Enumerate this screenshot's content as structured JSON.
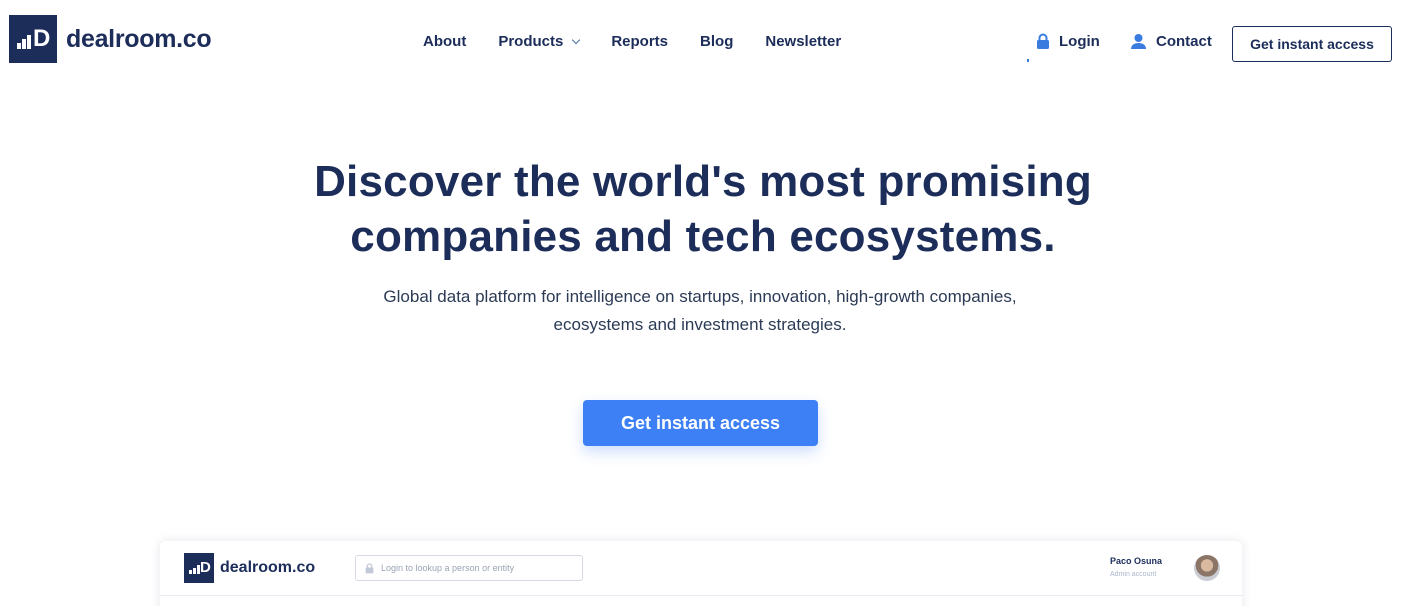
{
  "header": {
    "logo_text": "dealroom.co",
    "logo_mark_letter": "D",
    "nav": [
      {
        "label": "About"
      },
      {
        "label": "Products",
        "has_dropdown": true
      },
      {
        "label": "Reports"
      },
      {
        "label": "Blog"
      },
      {
        "label": "Newsletter"
      }
    ],
    "login_label": "Login",
    "contact_label": "Contact",
    "cta_label": "Get instant access",
    "icons": {
      "login": "lock-icon",
      "contact": "user-icon",
      "dropdown": "chevron-down-icon"
    }
  },
  "hero": {
    "title_line1": "Discover the world's most promising",
    "title_line2": "companies and tech ecosystems.",
    "subtitle_line1": "Global data platform for intelligence on startups, innovation, high-growth companies,",
    "subtitle_line2": "ecosystems and investment strategies.",
    "cta_label": "Get instant access"
  },
  "preview": {
    "logo_text": "dealroom.co",
    "logo_mark_letter": "D",
    "search_placeholder": "Login to lookup a person or entity",
    "user_name": "Paco Osuna",
    "user_role": "Admin account"
  },
  "colors": {
    "brand_navy": "#1c2d5a",
    "accent_blue": "#3d7ff5",
    "icon_blue": "#3a7be0"
  }
}
